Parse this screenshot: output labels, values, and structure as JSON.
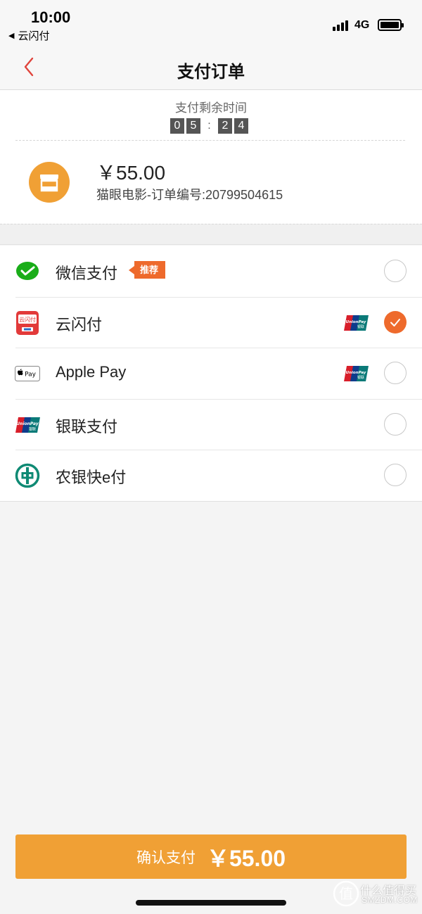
{
  "status_bar": {
    "time": "10:00",
    "back_app": "云闪付",
    "network": "4G"
  },
  "nav": {
    "title": "支付订单"
  },
  "order": {
    "timer_label": "支付剩余时间",
    "timer_digits": [
      "0",
      "5",
      "2",
      "4"
    ],
    "timer_separator": ":",
    "amount": "￥55.00",
    "description": "猫眼电影-订单编号:20799504615"
  },
  "payment_methods": [
    {
      "label": "微信支付",
      "badge": "推荐",
      "icon": "wechat-pay-icon",
      "checked": false
    },
    {
      "label": "云闪付",
      "icon": "quickpass-icon",
      "card": "unionpay-card-icon",
      "checked": true
    },
    {
      "label": "Apple Pay",
      "icon": "apple-pay-icon",
      "card": "unionpay-card-icon",
      "checked": false
    },
    {
      "label": "银联支付",
      "icon": "unionpay-icon",
      "checked": false
    },
    {
      "label": "农银快e付",
      "icon": "abc-bank-icon",
      "checked": false
    }
  ],
  "confirm": {
    "label": "确认支付",
    "amount": "￥55.00"
  },
  "watermark": {
    "text": "什么值得买",
    "sub": "SMZDM.COM"
  },
  "colors": {
    "accent_orange": "#f0a035",
    "check_orange": "#ee6a2c",
    "wechat_green": "#1aad19"
  }
}
